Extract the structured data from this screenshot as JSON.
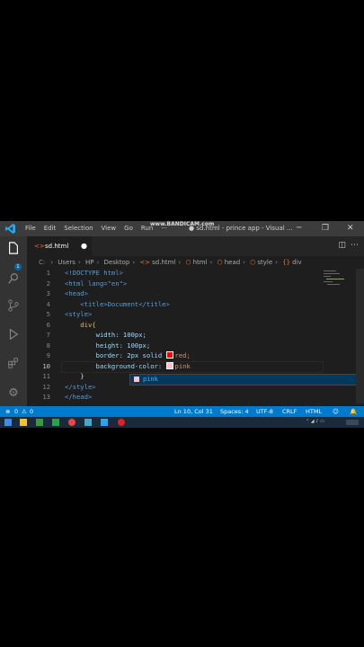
{
  "recording": {
    "watermark": "www.BANDICAM.com"
  },
  "titlebar": {
    "menu": [
      "File",
      "Edit",
      "Selection",
      "View",
      "Go",
      "Run",
      "···"
    ],
    "window_title": "● sd.html - prince app - Visual ..."
  },
  "activitybar": {
    "icons": [
      "files-icon",
      "search-icon",
      "source-control-icon",
      "run-debug-icon",
      "extensions-icon",
      "settings-gear-icon"
    ],
    "badge": "1"
  },
  "tab": {
    "label": "sd.html",
    "dirty_marker": "●"
  },
  "breadcrumb": [
    "Users",
    "HP",
    "Desktop",
    "sd.html",
    "html",
    "head",
    "style",
    "div"
  ],
  "editor": {
    "line_numbers": [
      "1",
      "2",
      "3",
      "4",
      "5",
      "6",
      "7",
      "8",
      "9",
      "10",
      "11",
      "12",
      "13"
    ],
    "current_line": "10",
    "lines": [
      "<!DOCTYPE html>",
      "<html lang=\"en\">",
      "<head>",
      "    <title>Document</title>",
      "<style>",
      "    div{",
      "        width: 100px;",
      "        height: 100px;",
      "        border: 2px solid red;",
      "        background-color: pink",
      "    }",
      "</style>",
      "</head>"
    ],
    "suggestion": "pink",
    "colors": {
      "red": "#ff0000",
      "pink": "#ffc0cb"
    }
  },
  "statusbar": {
    "errors": "0",
    "warnings": "0",
    "position": "Ln 10, Col 31",
    "spaces": "Spaces: 4",
    "encoding": "UTF-8",
    "eol": "CRLF",
    "language": "HTML",
    "colors": {
      "background": "#007acc"
    }
  }
}
